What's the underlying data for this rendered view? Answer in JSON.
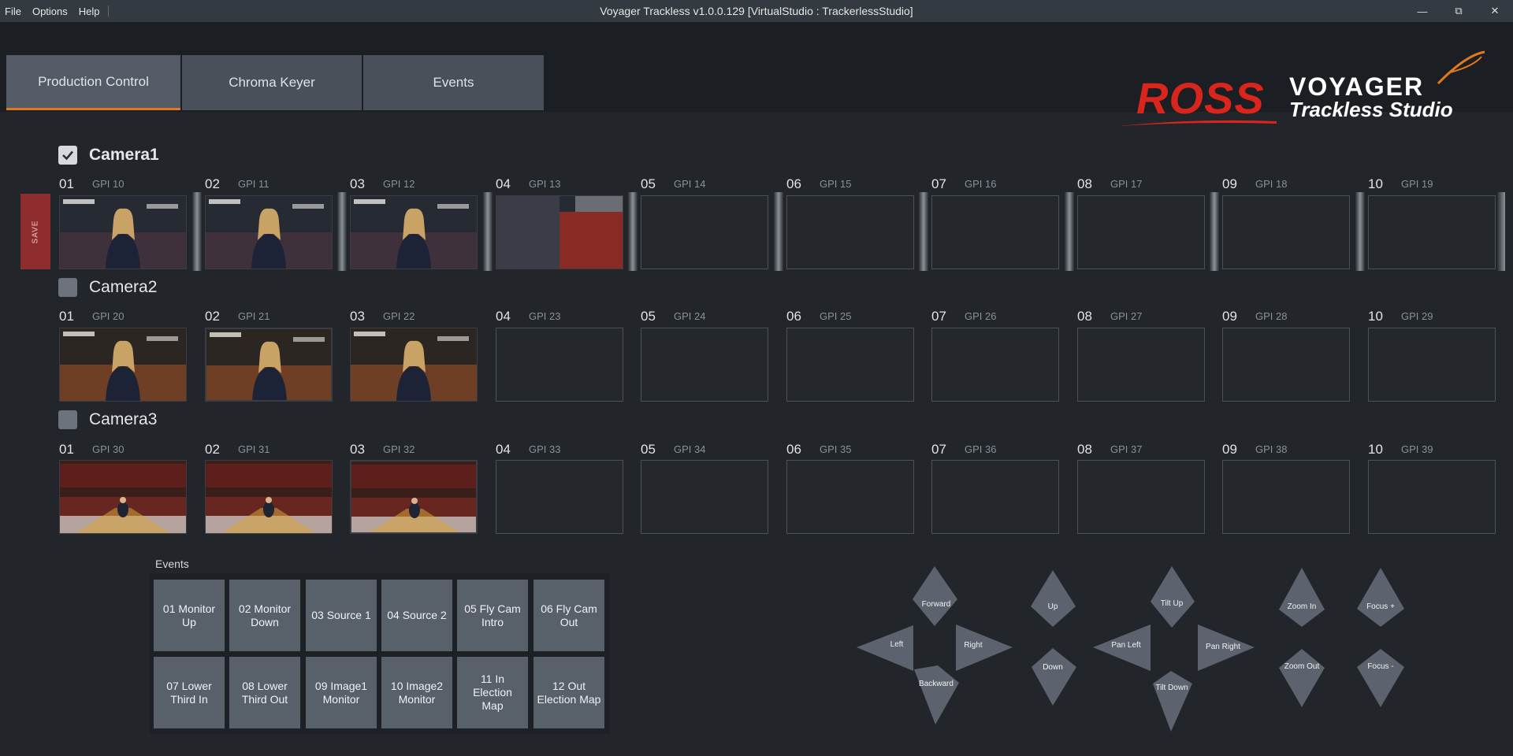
{
  "titlebar": {
    "menu": [
      "File",
      "Options",
      "Help"
    ],
    "title": "Voyager Trackless v1.0.0.129 [VirtualStudio : TrackerlessStudio]"
  },
  "tabs": [
    {
      "label": "Production Control",
      "active": true
    },
    {
      "label": "Chroma Keyer",
      "active": false
    },
    {
      "label": "Events",
      "active": false
    }
  ],
  "logo": {
    "brand": "ROSS",
    "product_line1": "VOYAGER",
    "product_line2": "Trackless Studio"
  },
  "save_label": "SAVE",
  "cameras": [
    {
      "label": "Camera1",
      "checked": true,
      "slots": [
        {
          "num": "01",
          "gpi": "GPI 10",
          "filled": true
        },
        {
          "num": "02",
          "gpi": "GPI 11",
          "filled": true
        },
        {
          "num": "03",
          "gpi": "GPI 12",
          "filled": true
        },
        {
          "num": "04",
          "gpi": "GPI 13",
          "filled": true
        },
        {
          "num": "05",
          "gpi": "GPI 14",
          "filled": false
        },
        {
          "num": "06",
          "gpi": "GPI 15",
          "filled": false
        },
        {
          "num": "07",
          "gpi": "GPI 16",
          "filled": false
        },
        {
          "num": "08",
          "gpi": "GPI 17",
          "filled": false
        },
        {
          "num": "09",
          "gpi": "GPI 18",
          "filled": false
        },
        {
          "num": "10",
          "gpi": "GPI 19",
          "filled": false
        }
      ]
    },
    {
      "label": "Camera2",
      "checked": false,
      "slots": [
        {
          "num": "01",
          "gpi": "GPI 20",
          "filled": true
        },
        {
          "num": "02",
          "gpi": "GPI 21",
          "filled": true,
          "selected": true
        },
        {
          "num": "03",
          "gpi": "GPI 22",
          "filled": true
        },
        {
          "num": "04",
          "gpi": "GPI 23",
          "filled": false
        },
        {
          "num": "05",
          "gpi": "GPI 24",
          "filled": false
        },
        {
          "num": "06",
          "gpi": "GPI 25",
          "filled": false
        },
        {
          "num": "07",
          "gpi": "GPI 26",
          "filled": false
        },
        {
          "num": "08",
          "gpi": "GPI 27",
          "filled": false
        },
        {
          "num": "09",
          "gpi": "GPI 28",
          "filled": false
        },
        {
          "num": "10",
          "gpi": "GPI 29",
          "filled": false
        }
      ]
    },
    {
      "label": "Camera3",
      "checked": false,
      "slots": [
        {
          "num": "01",
          "gpi": "GPI 30",
          "filled": true
        },
        {
          "num": "02",
          "gpi": "GPI 31",
          "filled": true
        },
        {
          "num": "03",
          "gpi": "GPI 32",
          "filled": true,
          "selected": true
        },
        {
          "num": "04",
          "gpi": "GPI 33",
          "filled": false
        },
        {
          "num": "05",
          "gpi": "GPI 34",
          "filled": false
        },
        {
          "num": "06",
          "gpi": "GPI 35",
          "filled": false
        },
        {
          "num": "07",
          "gpi": "GPI 36",
          "filled": false
        },
        {
          "num": "08",
          "gpi": "GPI 37",
          "filled": false
        },
        {
          "num": "09",
          "gpi": "GPI 38",
          "filled": false
        },
        {
          "num": "10",
          "gpi": "GPI 39",
          "filled": false
        }
      ]
    }
  ],
  "events": {
    "title": "Events",
    "buttons": [
      {
        "line1": "01 Monitor",
        "line2": "Up"
      },
      {
        "line1": "02 Monitor",
        "line2": "Down"
      },
      {
        "line1": "03 Source 1",
        "line2": ""
      },
      {
        "line1": "04 Source 2",
        "line2": ""
      },
      {
        "line1": "05 Fly Cam",
        "line2": "Intro"
      },
      {
        "line1": "06 Fly Cam",
        "line2": "Out"
      },
      {
        "line1": "07 Lower",
        "line2": "Third In"
      },
      {
        "line1": "08 Lower",
        "line2": "Third Out"
      },
      {
        "line1": "09 Image1",
        "line2": "Monitor"
      },
      {
        "line1": "10 Image2",
        "line2": "Monitor"
      },
      {
        "line1": "11 In Election",
        "line2": "Map"
      },
      {
        "line1": "12 Out",
        "line2": "Election Map"
      }
    ]
  },
  "controls": {
    "forward": "Forward",
    "left": "Left",
    "right": "Right",
    "backward": "Backward",
    "up": "Up",
    "down": "Down",
    "tilt_up": "Tilt Up",
    "pan_left": "Pan Left",
    "pan_right": "Pan Right",
    "tilt_down": "Tilt Down",
    "zoom_in": "Zoom In",
    "zoom_out": "Zoom Out",
    "focus_plus": "Focus +",
    "focus_minus": "Focus -"
  },
  "colors": {
    "accent": "#e07a1f",
    "save": "#8f2c2e",
    "brand_red": "#d8261c"
  }
}
